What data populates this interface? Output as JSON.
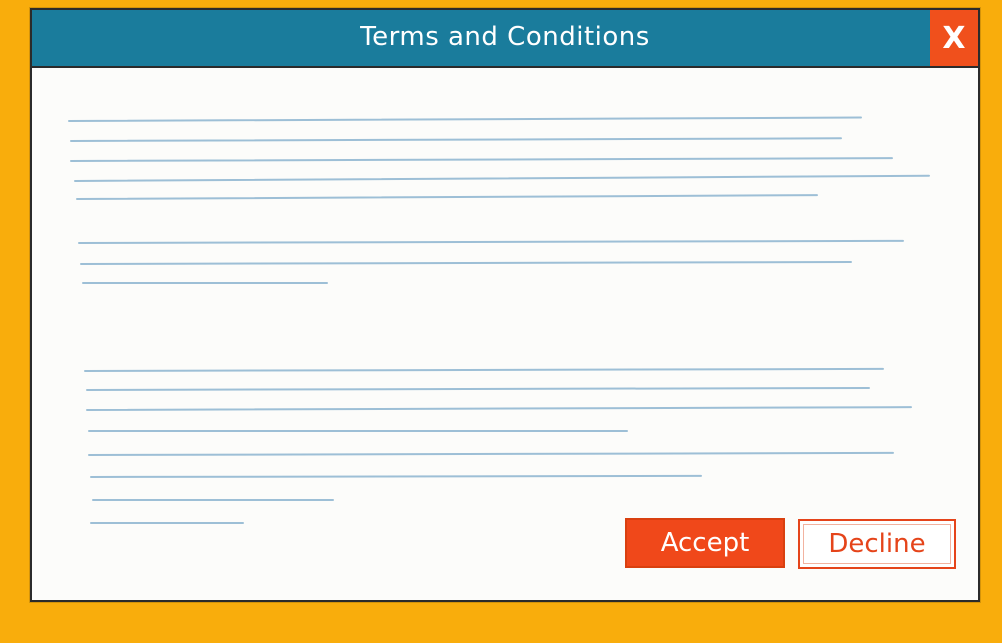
{
  "dialog": {
    "title": "Terms and Conditions",
    "close_icon": "close-icon",
    "close_label": "X",
    "accept_label": "Accept",
    "decline_label": "Decline"
  },
  "colors": {
    "background": "#f9ad0c",
    "titlebar": "#1a7c9c",
    "close": "#f0501c",
    "accept": "#f0481a",
    "decline_text": "#e5441a",
    "placeholder_lines": "#9dbfd6"
  }
}
